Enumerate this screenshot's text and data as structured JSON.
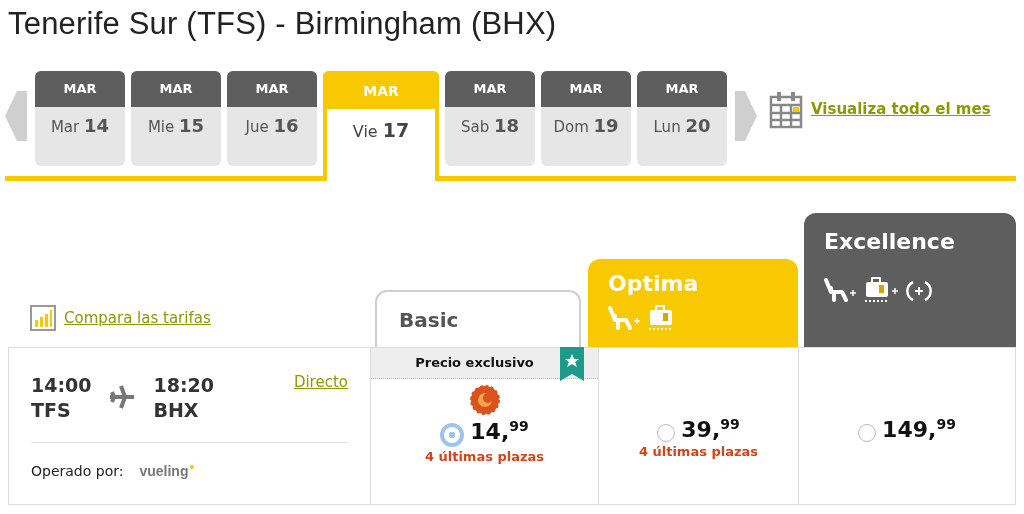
{
  "title": "Tenerife Sur (TFS) - Birmingham (BHX)",
  "dates": [
    {
      "month": "MAR",
      "label": "Mar **14**",
      "selected": false
    },
    {
      "month": "MAR",
      "label": "Mie **15**",
      "selected": false
    },
    {
      "month": "MAR",
      "label": "Jue **16**",
      "selected": false
    },
    {
      "month": "MAR",
      "label": "Vie **17**",
      "selected": true
    },
    {
      "month": "MAR",
      "label": "Sab **18**",
      "selected": false
    },
    {
      "month": "MAR",
      "label": "Dom **19**",
      "selected": false
    },
    {
      "month": "MAR",
      "label": "Lun **20**",
      "selected": false
    }
  ],
  "month_link": "Visualiza todo el mes",
  "compare_link": "Compara las tarifas",
  "flight": {
    "depart_time": "14:00",
    "depart_code": "TFS",
    "arrive_time": "18:20",
    "arrive_code": "BHX",
    "stops_link": "Directo",
    "operated_label": "Operado por:",
    "carrier": "vueling"
  },
  "fares": [
    {
      "name": "Basic",
      "kind": "basic",
      "badge": "Precio exclusivo",
      "price": "14,$^{99}$",
      "selected": true,
      "availability": "4 últimas plazas"
    },
    {
      "name": "Optima",
      "kind": "optima",
      "price": "39,$^{99}$",
      "selected": false,
      "availability": "4 últimas plazas"
    },
    {
      "name": "Excellence",
      "kind": "excellence",
      "price": "149,$^{99}$",
      "selected": false
    }
  ]
}
